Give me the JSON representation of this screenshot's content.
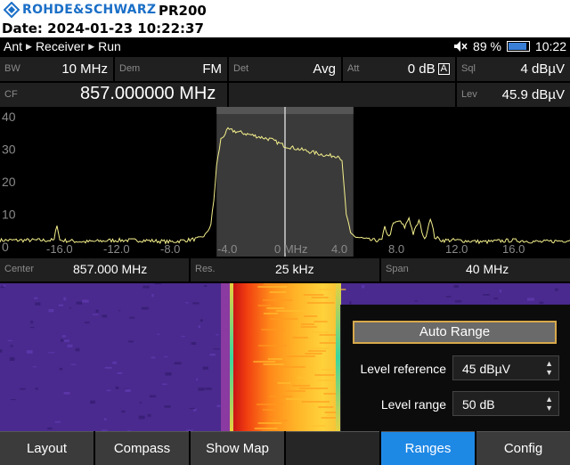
{
  "header": {
    "brand": "ROHDE&SCHWARZ",
    "model": "PR200",
    "date_line": "Date: 2024-01-23 10:22:37"
  },
  "status": {
    "crumbs": [
      "Ant",
      "Receiver",
      "Run"
    ],
    "battery_percent": "89 %",
    "battery_level": 0.89,
    "time": "10:22"
  },
  "params_row1": [
    {
      "label": "BW",
      "value": "10 MHz"
    },
    {
      "label": "Dem",
      "value": "FM"
    },
    {
      "label": "Det",
      "value": "Avg"
    },
    {
      "label": "Att",
      "value": "0 dB"
    },
    {
      "label": "Sql",
      "value": "4 dBµV"
    }
  ],
  "att_flag": "A",
  "params_row2": {
    "cf_label": "CF",
    "cf_value": "857.000000 MHz",
    "lev_label": "Lev",
    "lev_value": "45.9 dBµV"
  },
  "infobar": {
    "center_label": "Center",
    "center_value": "857.000 MHz",
    "res_label": "Res.",
    "res_value": "25 kHz",
    "span_label": "Span",
    "span_value": "40 MHz"
  },
  "ranges_panel": {
    "auto_range": "Auto Range",
    "level_reference_label": "Level reference",
    "level_reference_value": "45 dBµV",
    "level_range_label": "Level range",
    "level_range_value": "50 dB"
  },
  "softkeys": [
    "Layout",
    "Compass",
    "Show Map",
    "",
    "Ranges",
    "Config"
  ],
  "active_softkey": "Ranges",
  "colors": {
    "accent": "#1e88e5",
    "trace": "#f5f08c",
    "brand": "#1a6fc7",
    "focus_border": "#d7a84a"
  },
  "chart_data": {
    "type": "line",
    "y_ticks": [
      "40",
      "30",
      "20",
      "10",
      "0"
    ],
    "x_ticks": [
      "-16.0",
      "-12.0",
      "-8.0",
      "-4.0",
      "0 MHz",
      "4.0",
      "8.0",
      "12.0",
      "16.0"
    ],
    "xlim": [
      -20,
      20
    ],
    "ylim": [
      -3,
      43
    ],
    "grid": false,
    "highlight_band": [
      -4.8,
      4.8
    ],
    "marker_x": 0,
    "series": [
      {
        "x": [
          -20,
          -18,
          -16.2,
          -16,
          -15.8,
          -14,
          -12,
          -10,
          -8,
          -6,
          -5.5,
          -5.2,
          -5.0,
          -4.8,
          -4.5,
          -4.0,
          -3,
          -2,
          -1,
          0,
          1,
          2,
          3,
          3.8,
          4.0,
          4.3,
          4.6,
          5,
          6,
          6.8,
          7,
          7.3,
          7.6,
          8,
          8.4,
          8.7,
          9,
          9.4,
          9.8,
          10.2,
          10.5,
          11,
          12,
          14,
          16,
          18,
          20
        ],
        "y": [
          2,
          2,
          2,
          7,
          2,
          1.5,
          2,
          2,
          1.5,
          2.5,
          4,
          7,
          14,
          25,
          33,
          36,
          35,
          34,
          33,
          31,
          30,
          29,
          28,
          28,
          26,
          10,
          4,
          3,
          2,
          2,
          6,
          3,
          7,
          8,
          6,
          9,
          4,
          8,
          2,
          9,
          3,
          2,
          2,
          1.5,
          2,
          1.5,
          2
        ]
      }
    ]
  }
}
